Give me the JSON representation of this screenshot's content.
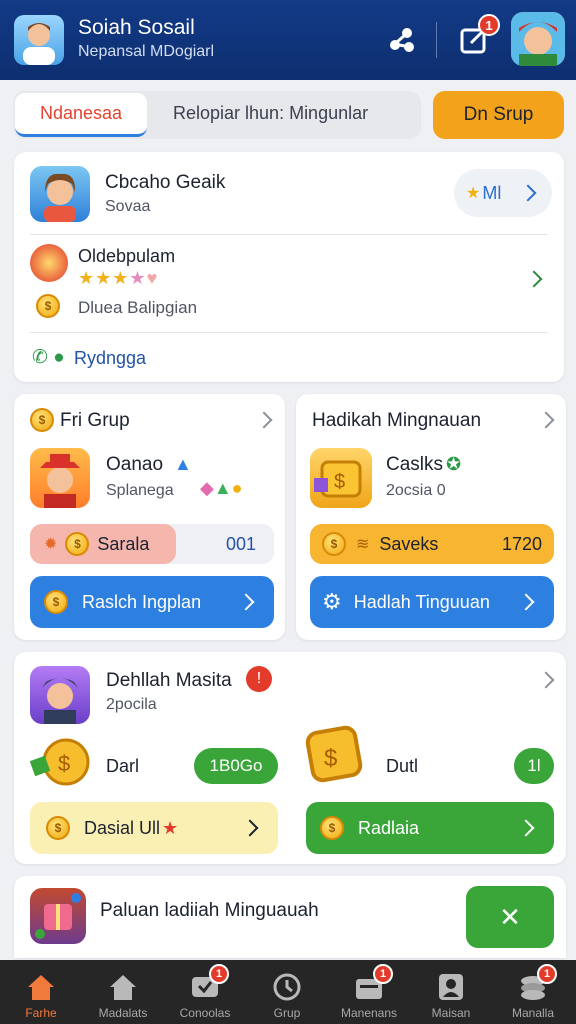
{
  "header": {
    "title": "Soiah Sosail",
    "subtitle": "Nepansal MDogiarl",
    "notif_badge": "1"
  },
  "tabs": [
    {
      "label": "Ndanesaa",
      "active": true
    },
    {
      "label": "Relopiar lhun: Mingunlar",
      "active": false
    }
  ],
  "group_button": "Dn Srup",
  "profile_card": {
    "name": "Cbcaho Geaik",
    "sub": "Sovaa",
    "pill_label": "Ml",
    "reward_title": "Oldebpulam",
    "reward_sub": "Dluea Balipgian",
    "footer_link": "Rydngga",
    "stars": 5
  },
  "left_card": {
    "title": "Fri Grup",
    "user": "Oanao",
    "user_sub": "Splanega",
    "progress_label": "Sarala",
    "progress_value": "001",
    "progress_fraction": 0.6,
    "button_label": "Raslch Ingplan"
  },
  "right_card": {
    "title": "Hadikah Mingnauan",
    "item": "Caslks",
    "item_sub": "2ocsia 0",
    "progress_label": "Saveks",
    "progress_value": "1720",
    "button_label": "Hadlah Tinguuan"
  },
  "mission_card": {
    "title": "Dehllah Masita",
    "sub": "2pocila",
    "left_label": "Darl",
    "left_pill": "1B0Go",
    "left_button": "Dasial Ull",
    "right_label": "Dutl",
    "right_pill": "1l",
    "right_button": "Radlaia"
  },
  "banner": {
    "text": "Paluan ladiiah Minguauah"
  },
  "nav": [
    {
      "label": "Farhe",
      "icon": "home-icon",
      "active": true,
      "badge": ""
    },
    {
      "label": "Madalats",
      "icon": "house-icon",
      "active": false,
      "badge": ""
    },
    {
      "label": "Conoolas",
      "icon": "chat-icon",
      "active": false,
      "badge": "1"
    },
    {
      "label": "Grup",
      "icon": "clock-icon",
      "active": false,
      "badge": ""
    },
    {
      "label": "Manenans",
      "icon": "folder-icon",
      "active": false,
      "badge": "1"
    },
    {
      "label": "Maisan",
      "icon": "person-icon",
      "active": false,
      "badge": ""
    },
    {
      "label": "Manalla",
      "icon": "stack-icon",
      "active": false,
      "badge": "1"
    }
  ],
  "colors": {
    "header": "#123a86",
    "accent_orange": "#f3a31b",
    "blue_button": "#2d7fe0",
    "green_button": "#3aa63a",
    "nav_active": "#f07a3c"
  }
}
